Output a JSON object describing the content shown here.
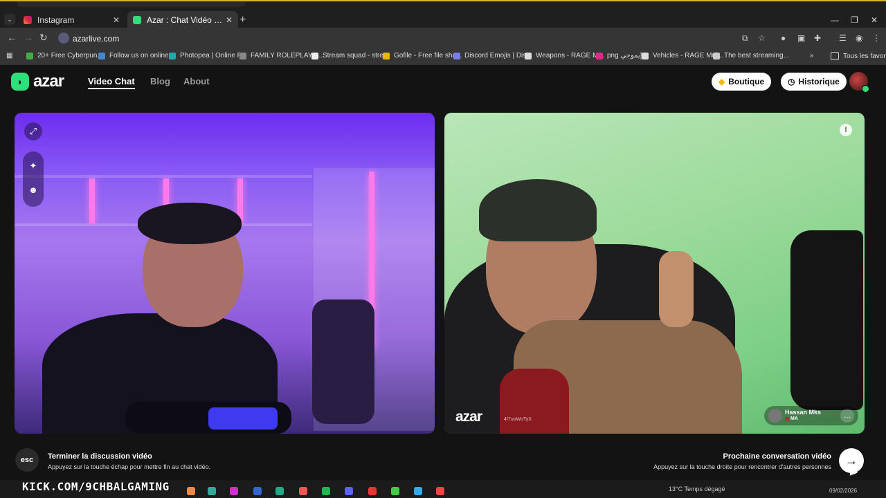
{
  "browser": {
    "tabs": [
      {
        "title": "Instagram",
        "active": false
      },
      {
        "title": "Azar : Chat Vidéo avec de n",
        "active": true
      }
    ],
    "url": "azarlive.com",
    "bookmarks": [
      "20+ Free Cyberpun...",
      "Follow us on online...",
      "Photopea | Online P...",
      "FAMILY ROLEPLAY S...",
      "Stream squad - stre...",
      "Gofile - Free file sha...",
      "Discord Emojis | Dis...",
      "Weapons - RAGE M...",
      "png إيموجي",
      "Vehicles - RAGE Mul...",
      "The best streaming..."
    ],
    "bookmarks_folder": "Tous les favoris"
  },
  "app": {
    "logo": "azar",
    "nav": [
      "Video Chat",
      "Blog",
      "About"
    ],
    "active_nav": "Video Chat",
    "boutique_label": "Boutique",
    "historique_label": "Historique"
  },
  "remote": {
    "watermark": "azar",
    "watermark_id": "4f7uoWuTyX",
    "peer_name": "Hassan Mks",
    "peer_country": "MA"
  },
  "controls": {
    "esc_key": "esc",
    "end_title": "Terminer la discussion vidéo",
    "end_sub": "Appuyez sur la touche échap pour mettre fin au chat vidéo.",
    "next_title": "Prochaine conversation vidéo",
    "next_sub": "Appuyez sur la touche droite pour rencontrer d'autres personnes"
  },
  "overlay": {
    "kick": "KICK.COM/9CHBALGAMING"
  },
  "taskbar": {
    "weather": "13°C  Temps dégagé",
    "date": "09/02/2026"
  },
  "colors": {
    "brand_green": "#2ee07a",
    "accent_gold": "#d6b52a"
  }
}
